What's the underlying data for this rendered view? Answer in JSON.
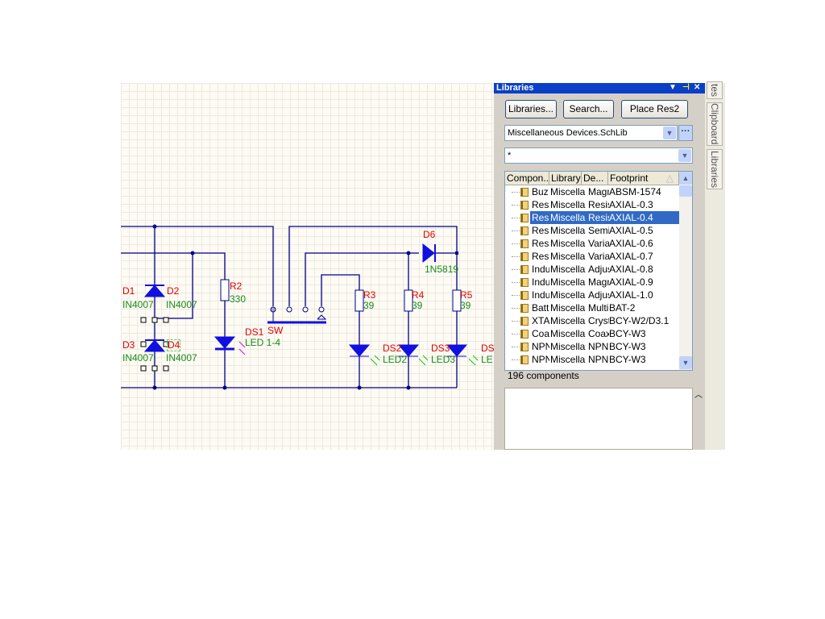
{
  "schematic": {
    "designators": {
      "D1": "D1",
      "D2": "D2",
      "D3": "D3",
      "D4": "D4",
      "D6": "D6",
      "R2": "R2",
      "R3": "R3",
      "R4": "R4",
      "R5": "R5",
      "DS1": "DS1",
      "DS2": "DS2",
      "DS3": "DS3",
      "DS4": "DS",
      "SW": "SW"
    },
    "values": {
      "D1": "IN4007",
      "D2": "IN4007",
      "D3": "IN4007",
      "D4": "IN4007",
      "D6": "1N5819",
      "R2": "330",
      "R3": "39",
      "R4": "39",
      "R5": "39",
      "DS1": "LED 1-4",
      "DS2": "LED2",
      "DS3": "LED3",
      "DS4": "LE"
    },
    "colors": {
      "wire": "#00008b",
      "part": "#1010e0",
      "designator": "#e00000",
      "value": "#1a8a1a"
    }
  },
  "panel": {
    "title": "Libraries",
    "buttons": {
      "libraries": "Libraries...",
      "search": "Search...",
      "place": "Place Res2"
    },
    "library_select": "Miscellaneous Devices.SchLib",
    "filter": "*",
    "columns": [
      "Compon...",
      "Library",
      "De...",
      "Footprint"
    ],
    "rows": [
      {
        "name": "Buz",
        "library": "Miscella",
        "desc": "Magne",
        "footprint": "ABSM-1574"
      },
      {
        "name": "Res",
        "library": "Miscella",
        "desc": "Resist",
        "footprint": "AXIAL-0.3"
      },
      {
        "name": "Res",
        "library": "Miscella",
        "desc": "Resist",
        "footprint": "AXIAL-0.4",
        "selected": true
      },
      {
        "name": "Res",
        "library": "Miscella",
        "desc": "Semic",
        "footprint": "AXIAL-0.5"
      },
      {
        "name": "Res",
        "library": "Miscella",
        "desc": "Variat",
        "footprint": "AXIAL-0.6"
      },
      {
        "name": "Res",
        "library": "Miscella",
        "desc": "Variat",
        "footprint": "AXIAL-0.7"
      },
      {
        "name": "Indu",
        "library": "Miscella",
        "desc": "Adjust",
        "footprint": "AXIAL-0.8"
      },
      {
        "name": "Indu",
        "library": "Miscella",
        "desc": "Magne",
        "footprint": "AXIAL-0.9"
      },
      {
        "name": "Indu",
        "library": "Miscella",
        "desc": "Adjust",
        "footprint": "AXIAL-1.0"
      },
      {
        "name": "Batt",
        "library": "Miscella",
        "desc": "Multic",
        "footprint": "BAT-2"
      },
      {
        "name": "XTA",
        "library": "Miscella",
        "desc": "Crysta",
        "footprint": "BCY-W2/D3.1"
      },
      {
        "name": "Coa",
        "library": "Miscella",
        "desc": "Coaxia",
        "footprint": "BCY-W3"
      },
      {
        "name": "NPN",
        "library": "Miscella",
        "desc": "NPN I",
        "footprint": "BCY-W3"
      },
      {
        "name": "NPN",
        "library": "Miscella",
        "desc": "NPN I",
        "footprint": "BCY-W3"
      }
    ],
    "count": "196 components"
  },
  "side_tabs": [
    "tes",
    "Clipboard",
    "Libraries"
  ]
}
